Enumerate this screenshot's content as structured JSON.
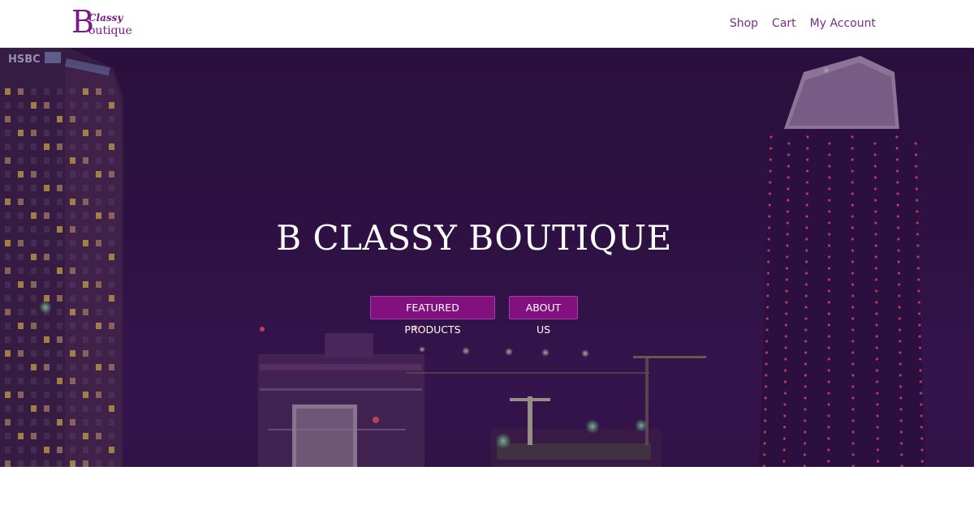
{
  "logo": {
    "initial": "B",
    "top_word": "Classy",
    "bottom_word": "outique"
  },
  "nav": {
    "shop": "Shop",
    "cart": "Cart",
    "account": "My Account"
  },
  "hero": {
    "title": "B CLASSY BOUTIQUE",
    "featured_button": "FEATURED PRODUCTS",
    "about_button": "ABOUT US",
    "sign_text": "HSBC"
  },
  "colors": {
    "brand": "#7a1a86",
    "button": "#82117f",
    "hero_overlay": "#2f1243"
  }
}
